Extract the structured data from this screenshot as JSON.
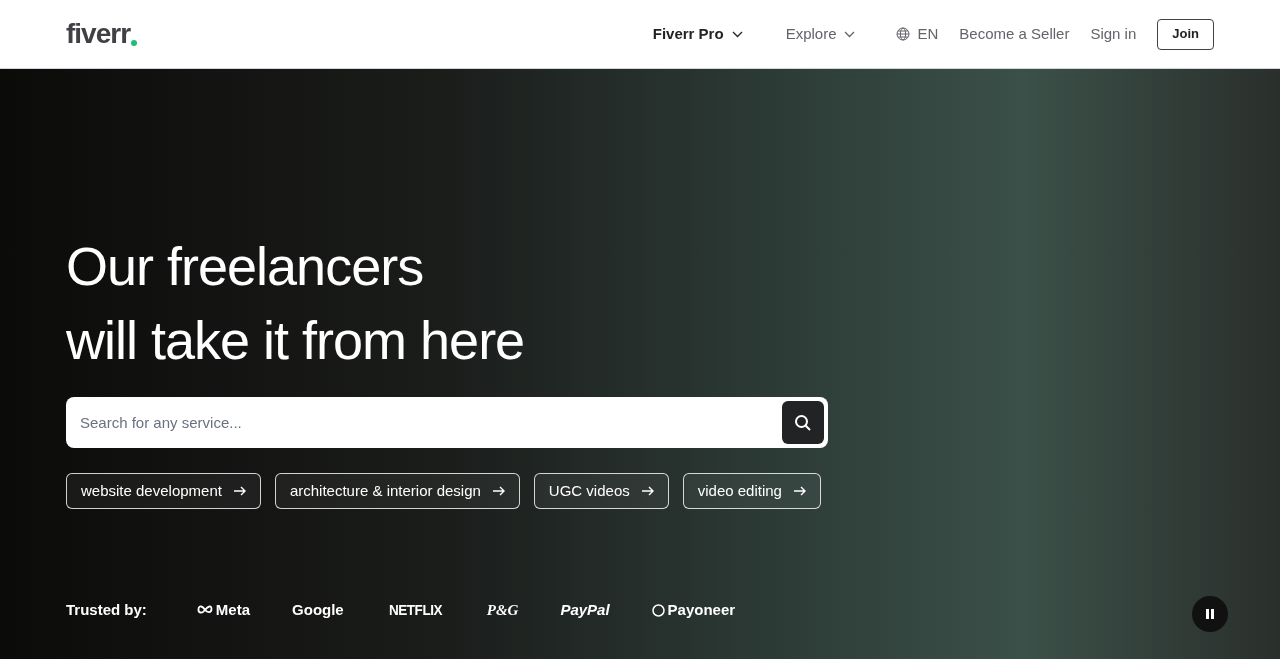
{
  "header": {
    "logo": "fiverr",
    "nav": [
      {
        "label": "Fiverr Pro",
        "kind": "dropdown"
      },
      {
        "label": "Explore",
        "kind": "dropdown"
      },
      {
        "label": "EN",
        "kind": "language"
      },
      {
        "label": "Become a Seller",
        "kind": "link"
      },
      {
        "label": "Sign in",
        "kind": "link"
      },
      {
        "label": "Join",
        "kind": "button"
      }
    ]
  },
  "hero": {
    "headline_lines": [
      "Our freelancers",
      "will take it from here"
    ],
    "search": {
      "placeholder": "Search for any service..."
    },
    "suggestions": [
      "website development",
      "architecture & interior design",
      "UGC videos",
      "video editing"
    ],
    "trusted_label": "Trusted by:",
    "trusted_logos": [
      {
        "name": "Meta",
        "kind": "meta"
      },
      {
        "name": "Google",
        "kind": "plain"
      },
      {
        "name": "NETFLIX",
        "kind": "condensed"
      },
      {
        "name": "P&G",
        "kind": "italic"
      },
      {
        "name": "PayPal",
        "kind": "italic-bold"
      },
      {
        "name": "Payoneer",
        "kind": "payoneer"
      }
    ]
  }
}
